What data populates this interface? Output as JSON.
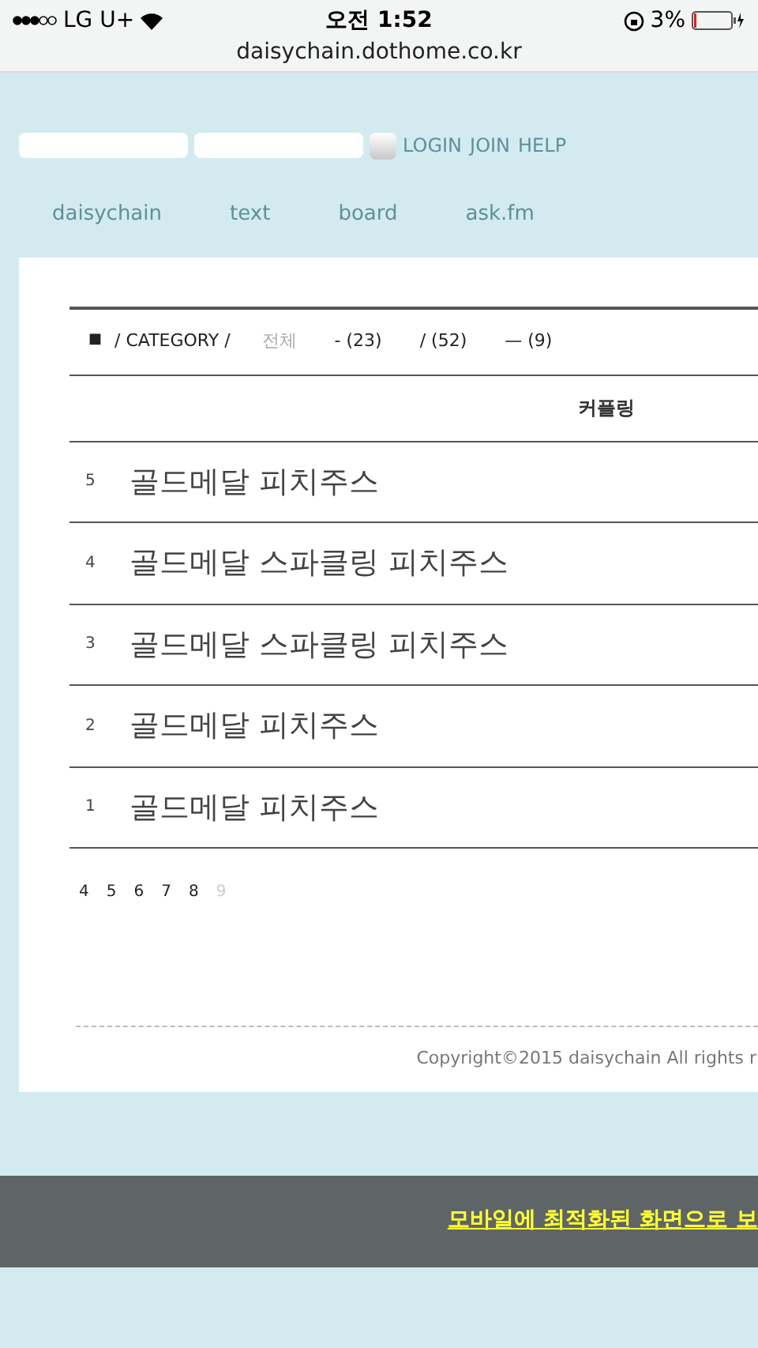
{
  "status_bar": {
    "carrier": "LG U+",
    "time": "오전 1:52",
    "battery": "3%",
    "url": "daisychain.dothome.co.kr"
  },
  "login": {
    "links": [
      "LOGIN",
      "JOIN",
      "HELP"
    ]
  },
  "nav": [
    "daisychain",
    "text",
    "board",
    "ask.fm"
  ],
  "category": {
    "marker": "■",
    "label": "/ CATEGORY /",
    "items": [
      {
        "label": "전체",
        "selected": true
      },
      {
        "label": "- (23)",
        "selected": false
      },
      {
        "label": "/ (52)",
        "selected": false
      },
      {
        "label": "— (9)",
        "selected": false
      }
    ]
  },
  "table": {
    "heading": "커플링",
    "rows": [
      {
        "number": "5",
        "title": "골드메달 피치주스"
      },
      {
        "number": "4",
        "title": "골드메달 스파클링 피치주스"
      },
      {
        "number": "3",
        "title": "골드메달 스파클링 피치주스"
      },
      {
        "number": "2",
        "title": "골드메달 피치주스"
      },
      {
        "number": "1",
        "title": "골드메달 피치주스"
      }
    ]
  },
  "pagination": [
    {
      "label": "4",
      "selected": false
    },
    {
      "label": "5",
      "selected": false
    },
    {
      "label": "6",
      "selected": false
    },
    {
      "label": "7",
      "selected": false
    },
    {
      "label": "8",
      "selected": false
    },
    {
      "label": "9",
      "selected": true
    }
  ],
  "footer": {
    "copyright": "Copyright©2015 daisychain All rights r"
  },
  "banner": {
    "text": "모바일에 최적화된 화면으로 보"
  }
}
